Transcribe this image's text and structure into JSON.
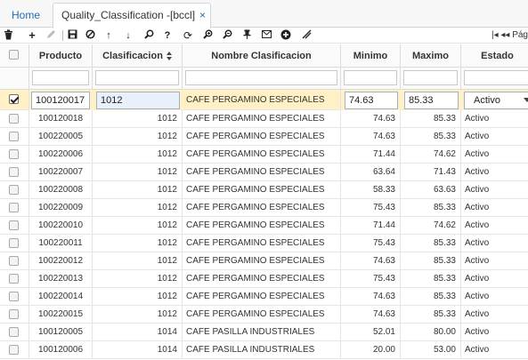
{
  "tabs": {
    "home_label": "Home",
    "active_label": "Quality_Classification -[bccl]",
    "close_glyph": "×"
  },
  "toolbar": {
    "icons": [
      "delete-icon",
      "add-icon",
      "edit-icon",
      "save-icon",
      "cancel-icon",
      "move-up-icon",
      "move-down-icon",
      "search-icon",
      "help-icon",
      "refresh-icon",
      "zoom-in-icon",
      "zoom-out-icon",
      "pin-icon",
      "mail-icon",
      "add-circle-icon",
      "expand-icon"
    ],
    "pager_label": "|◂ ◂◂ Pág"
  },
  "columns": {
    "producto": "Producto",
    "clasificacion": "Clasificacion",
    "nombre": "Nombre Clasificacion",
    "minimo": "Minimo",
    "maximo": "Maximo",
    "estado": "Estado"
  },
  "selected_row": {
    "producto": "100120017",
    "clasificacion": "1012",
    "nombre": "CAFE PERGAMINO ESPECIALES",
    "minimo": "74.63",
    "maximo": "85.33",
    "estado": "Activo"
  },
  "rows": [
    {
      "producto": "100120018",
      "clasificacion": "1012",
      "nombre": "CAFE PERGAMINO ESPECIALES",
      "minimo": "74.63",
      "maximo": "85.33",
      "estado": "Activo"
    },
    {
      "producto": "100220005",
      "clasificacion": "1012",
      "nombre": "CAFE PERGAMINO ESPECIALES",
      "minimo": "74.63",
      "maximo": "85.33",
      "estado": "Activo"
    },
    {
      "producto": "100220006",
      "clasificacion": "1012",
      "nombre": "CAFE PERGAMINO ESPECIALES",
      "minimo": "71.44",
      "maximo": "74.62",
      "estado": "Activo"
    },
    {
      "producto": "100220007",
      "clasificacion": "1012",
      "nombre": "CAFE PERGAMINO ESPECIALES",
      "minimo": "63.64",
      "maximo": "71.43",
      "estado": "Activo"
    },
    {
      "producto": "100220008",
      "clasificacion": "1012",
      "nombre": "CAFE PERGAMINO ESPECIALES",
      "minimo": "58.33",
      "maximo": "63.63",
      "estado": "Activo"
    },
    {
      "producto": "100220009",
      "clasificacion": "1012",
      "nombre": "CAFE PERGAMINO ESPECIALES",
      "minimo": "75.43",
      "maximo": "85.33",
      "estado": "Activo"
    },
    {
      "producto": "100220010",
      "clasificacion": "1012",
      "nombre": "CAFE PERGAMINO ESPECIALES",
      "minimo": "71.44",
      "maximo": "74.62",
      "estado": "Activo"
    },
    {
      "producto": "100220011",
      "clasificacion": "1012",
      "nombre": "CAFE PERGAMINO ESPECIALES",
      "minimo": "75.43",
      "maximo": "85.33",
      "estado": "Activo"
    },
    {
      "producto": "100220012",
      "clasificacion": "1012",
      "nombre": "CAFE PERGAMINO ESPECIALES",
      "minimo": "74.63",
      "maximo": "85.33",
      "estado": "Activo"
    },
    {
      "producto": "100220013",
      "clasificacion": "1012",
      "nombre": "CAFE PERGAMINO ESPECIALES",
      "minimo": "75.43",
      "maximo": "85.33",
      "estado": "Activo"
    },
    {
      "producto": "100220014",
      "clasificacion": "1012",
      "nombre": "CAFE PERGAMINO ESPECIALES",
      "minimo": "74.63",
      "maximo": "85.33",
      "estado": "Activo"
    },
    {
      "producto": "100220015",
      "clasificacion": "1012",
      "nombre": "CAFE PERGAMINO ESPECIALES",
      "minimo": "74.63",
      "maximo": "85.33",
      "estado": "Activo"
    },
    {
      "producto": "100120005",
      "clasificacion": "1014",
      "nombre": "CAFE PASILLA INDUSTRIALES",
      "minimo": "52.01",
      "maximo": "80.00",
      "estado": "Activo"
    },
    {
      "producto": "100120006",
      "clasificacion": "1014",
      "nombre": "CAFE PASILLA INDUSTRIALES",
      "minimo": "20.00",
      "maximo": "53.00",
      "estado": "Activo"
    }
  ],
  "colors": {
    "accent": "#1f6fb3",
    "selected_row_bg": "#fff1c5"
  }
}
